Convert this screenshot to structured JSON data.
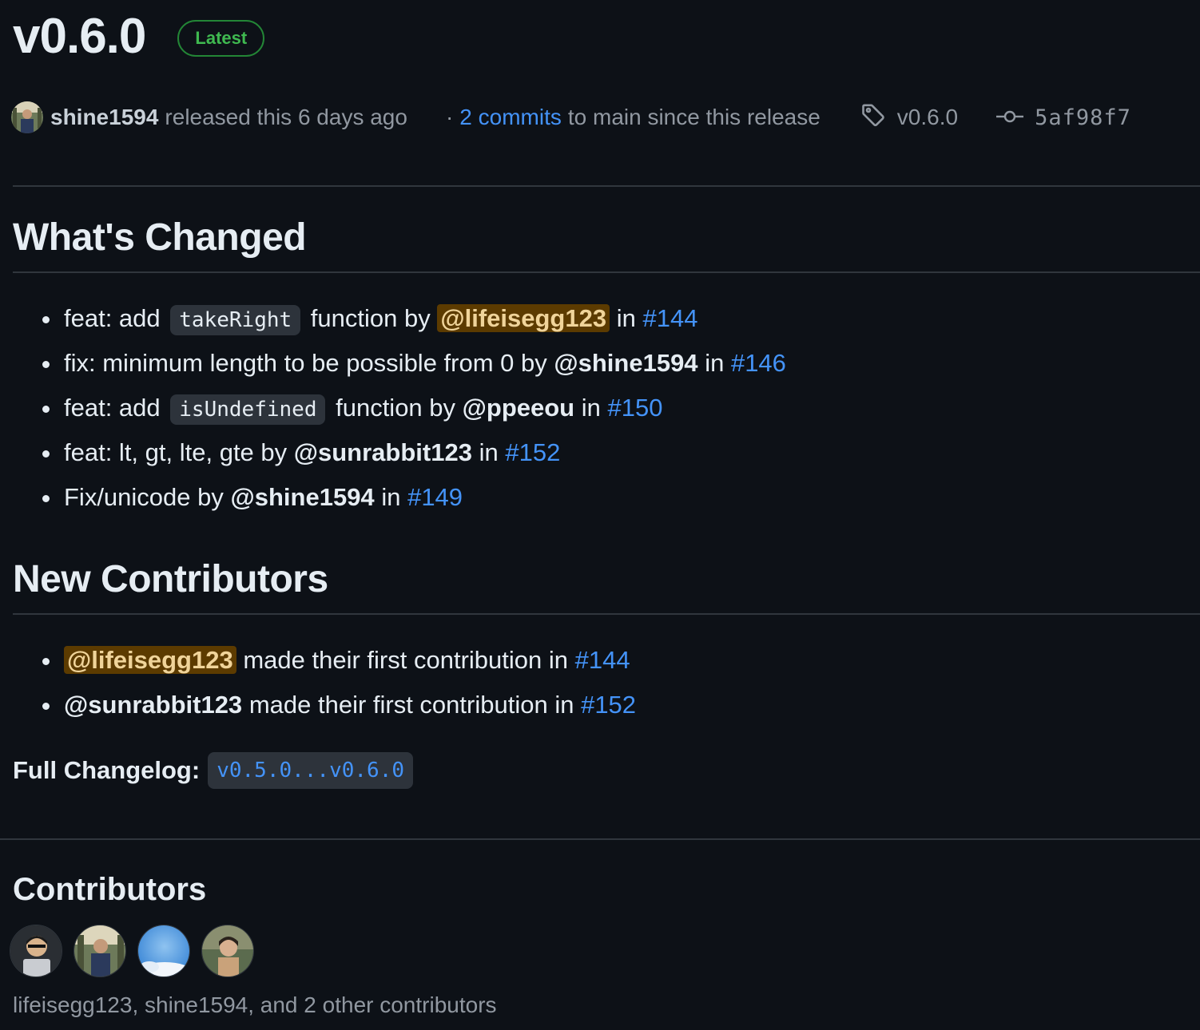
{
  "release": {
    "title": "v0.6.0",
    "badge": "Latest",
    "author": "shine1594",
    "released_text": "released this 6 days ago",
    "dot": "·",
    "commits_link": "2 commits",
    "commits_rest": "to main since this release",
    "tag": "v0.6.0",
    "commit_sha": "5af98f7"
  },
  "whats_changed": {
    "heading": "What's Changed",
    "items": [
      {
        "pre": "feat: add",
        "code": "takeRight",
        "mid": "function by",
        "mention": "@lifeisegg123",
        "post": "in",
        "pr": "#144"
      },
      {
        "pre": "fix: minimum length to be possible from 0 by",
        "mention": "@shine1594",
        "post": "in",
        "pr": "#146"
      },
      {
        "pre": "feat: add",
        "code": "isUndefined",
        "mid": "function by",
        "mention": "@ppeeou",
        "post": "in",
        "pr": "#150"
      },
      {
        "pre": "feat: lt, gt, lte, gte by",
        "mention": "@sunrabbit123",
        "post": "in",
        "pr": "#152"
      },
      {
        "pre": "Fix/unicode by",
        "mention": "@shine1594",
        "post": "in",
        "pr": "#149"
      }
    ]
  },
  "new_contributors": {
    "heading": "New Contributors",
    "items": [
      {
        "mention": "@lifeisegg123",
        "text": "made their first contribution in",
        "pr": "#144"
      },
      {
        "mention": "@sunrabbit123",
        "text": "made their first contribution in",
        "pr": "#152"
      }
    ]
  },
  "full_changelog": {
    "label": "Full Changelog:",
    "link": "v0.5.0...v0.6.0"
  },
  "contributors": {
    "heading": "Contributors",
    "summary": "lifeisegg123, shine1594, and 2 other contributors"
  },
  "colors": {
    "background": "#0d1117",
    "link": "#4493f8",
    "badge_green": "#3fb950",
    "mention_highlight": "#5c3b00"
  }
}
